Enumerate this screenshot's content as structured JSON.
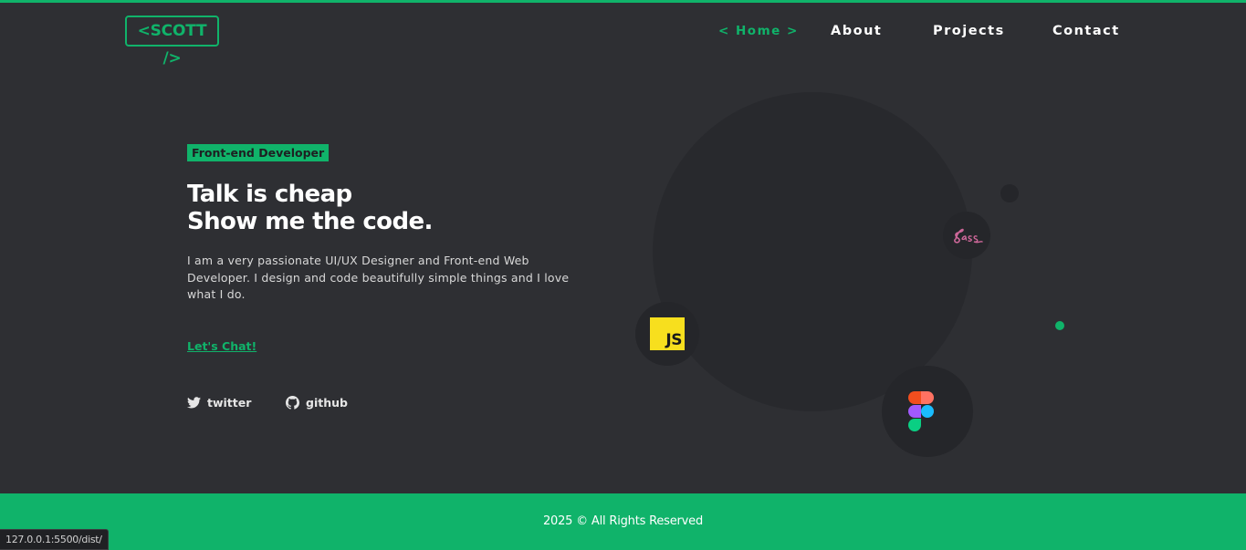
{
  "header": {
    "logo": "<SCOTT />",
    "nav": [
      {
        "label": "< Home >",
        "active": true
      },
      {
        "label": "About",
        "active": false
      },
      {
        "label": "Projects",
        "active": false
      },
      {
        "label": "Contact",
        "active": false
      }
    ]
  },
  "hero": {
    "tag": "Front-end Developer",
    "headline_line1": "Talk is cheap",
    "headline_line2": "Show me the code.",
    "description": "I am a very passionate UI/UX Designer and Front-end Web Developer. I design and code beautifully simple things and I love what I do.",
    "cta_label": "Let's Chat!",
    "socials": [
      {
        "label": "twitter",
        "icon": "twitter-icon"
      },
      {
        "label": "github",
        "icon": "github-icon"
      }
    ]
  },
  "skills": {
    "js_label": "JS",
    "sass_label": "Sass",
    "figma_icon": "figma-icon"
  },
  "footer": {
    "copyright": "2025 © All Rights Reserved"
  },
  "browser": {
    "status_url": "127.0.0.1:5500/dist/"
  },
  "colors": {
    "accent": "#10b36a",
    "background": "#2e2f33",
    "js_yellow": "#f7df1e",
    "sass_pink": "#cd6799"
  }
}
